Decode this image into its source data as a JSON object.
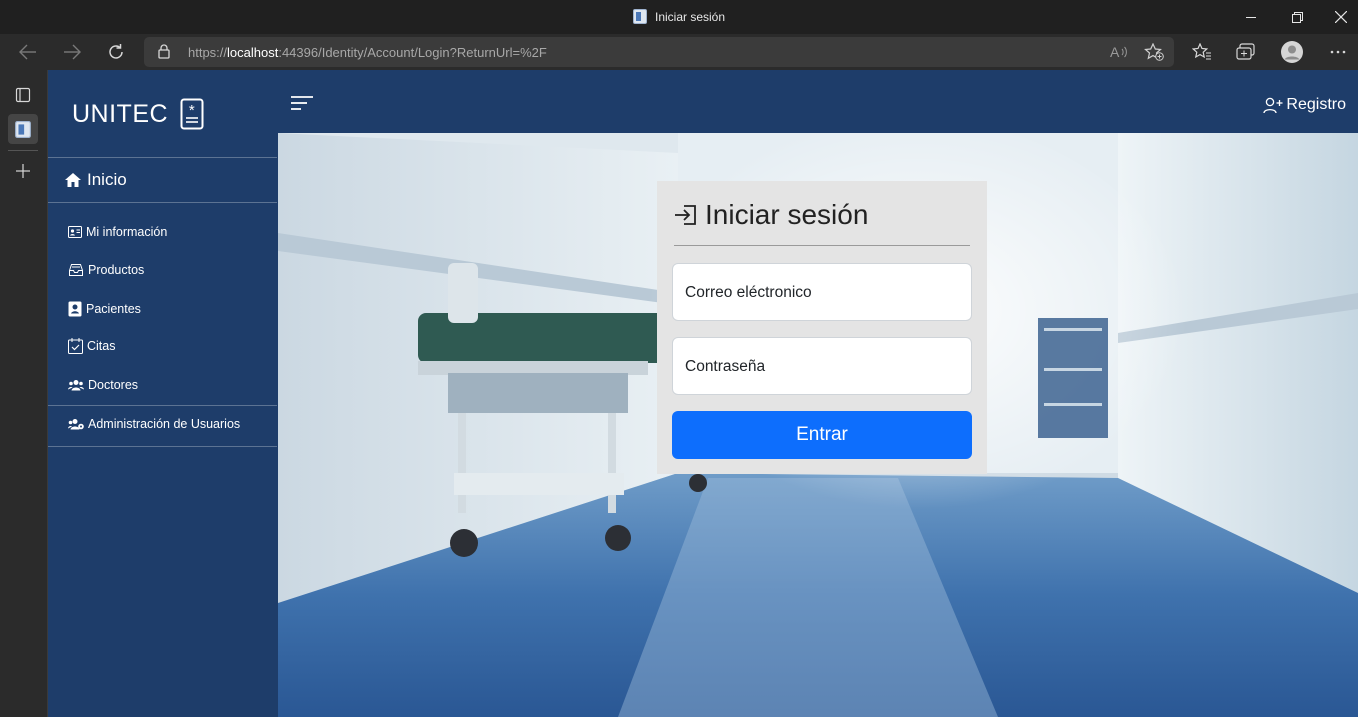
{
  "window": {
    "title": "Iniciar sesión"
  },
  "address_bar": {
    "url_prefix": "https://",
    "url_host": "localhost",
    "url_rest": ":44396/Identity/Account/Login?ReturnUrl=%2F"
  },
  "icons": {
    "back": "arrow-left-icon",
    "forward": "arrow-right-icon",
    "refresh": "refresh-icon",
    "lock": "lock-icon",
    "read_aloud": "read-aloud-icon",
    "add_favorite": "star-plus-icon",
    "favorites": "favorites-icon",
    "collections": "collections-icon",
    "profile": "profile-avatar-icon",
    "more": "ellipsis-icon"
  },
  "sidebar": {
    "brand": "UNITEC",
    "home_label": "Inicio",
    "items": [
      {
        "label": "Mi información",
        "icon": "id-card-icon"
      },
      {
        "label": "Productos",
        "icon": "inbox-tray-icon"
      },
      {
        "label": "Pacientes",
        "icon": "person-badge-icon"
      },
      {
        "label": "Citas",
        "icon": "calendar-check-icon"
      },
      {
        "label": "Doctores",
        "icon": "people-icon"
      },
      {
        "label": "Administración de Usuarios",
        "icon": "users-gear-icon"
      }
    ]
  },
  "topbar": {
    "register_label": "Registro"
  },
  "login": {
    "title": "Iniciar sesión",
    "email_placeholder": "Correo eléctronico",
    "password_placeholder": "Contraseña",
    "submit_label": "Entrar"
  },
  "colors": {
    "nav_bg": "#1e3d6a",
    "primary": "#0d6efd",
    "card_bg": "#e4e4e4"
  }
}
